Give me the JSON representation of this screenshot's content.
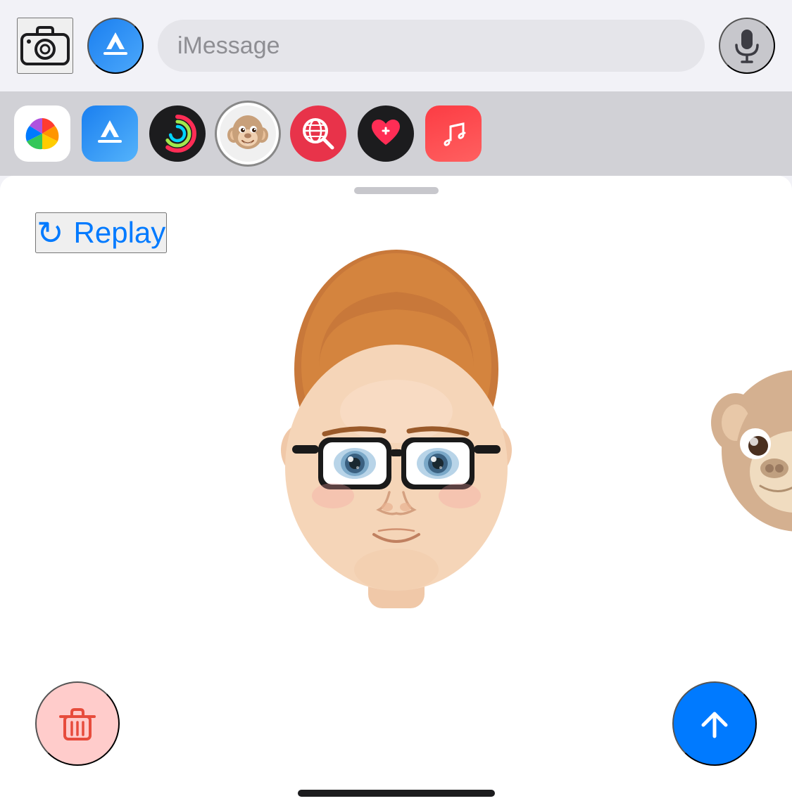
{
  "toolbar": {
    "imessage_placeholder": "iMessage",
    "camera_label": "Camera",
    "appstore_label": "App Store",
    "mic_label": "Microphone"
  },
  "app_icons_row": {
    "items": [
      {
        "name": "Photos",
        "key": "photos"
      },
      {
        "name": "App Store",
        "key": "appstore2"
      },
      {
        "name": "Activity",
        "key": "activity"
      },
      {
        "name": "Monkey / Animoji",
        "key": "monkey"
      },
      {
        "name": "WorldSearch",
        "key": "worldsearch"
      },
      {
        "name": "Heart App",
        "key": "heartapp"
      },
      {
        "name": "Music",
        "key": "music"
      }
    ]
  },
  "memoji_panel": {
    "replay_label": "Replay",
    "delete_label": "Delete",
    "send_label": "Send",
    "drag_handle": true
  },
  "colors": {
    "accent_blue": "#007aff",
    "delete_bg": "#ffcccb",
    "delete_icon": "#e74c3c",
    "send_bg": "#007aff",
    "panel_bg": "#ffffff",
    "toolbar_bg": "#f2f2f7",
    "icons_row_bg": "#d1d1d6"
  }
}
